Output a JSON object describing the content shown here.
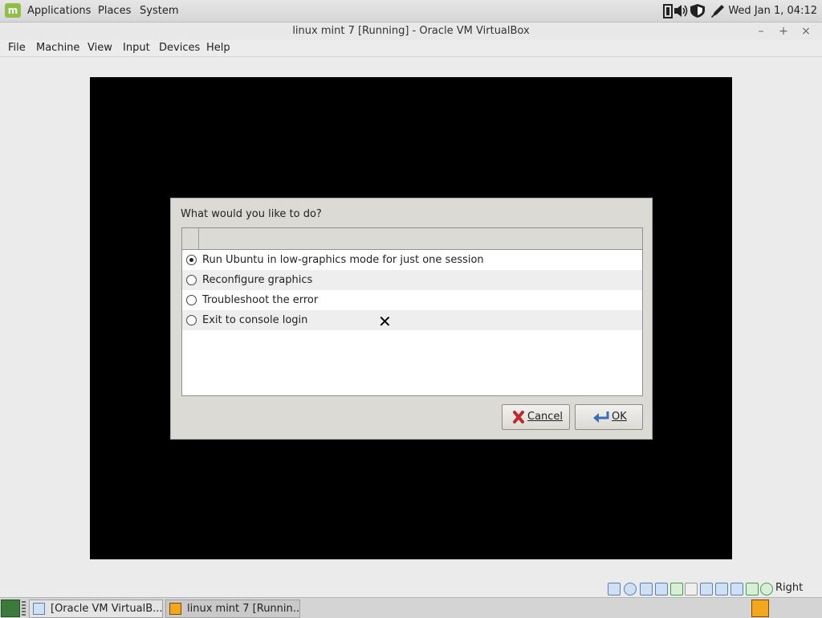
{
  "top_panel": {
    "logo_text": "m",
    "menus": [
      "Applications",
      "Places",
      "System"
    ],
    "clock": "Wed Jan  1, 04:12",
    "tray_icons": [
      "network-icon",
      "volume-icon",
      "shield-icon",
      "pen-icon"
    ]
  },
  "window": {
    "title": "linux mint 7 [Running] - Oracle VM VirtualBox",
    "controls": [
      "–",
      "+",
      "×"
    ],
    "menus": [
      "File",
      "Machine",
      "View",
      "Input",
      "Devices",
      "Help"
    ]
  },
  "dialog": {
    "prompt": "What would you like to do?",
    "options": [
      {
        "label": "Run Ubuntu in low-graphics mode for just one session",
        "selected": true
      },
      {
        "label": "Reconfigure graphics",
        "selected": false
      },
      {
        "label": "Troubleshoot the error",
        "selected": false
      },
      {
        "label": "Exit to console login",
        "selected": false
      }
    ],
    "cancel_label": "Cancel",
    "ok_label": "OK"
  },
  "cursor_glyph": "✕",
  "statusbar": {
    "host_key": "Right Ctrl"
  },
  "taskbar": {
    "tasks": [
      {
        "label": "[Oracle VM VirtualB...",
        "active": false
      },
      {
        "label": "linux mint 7 [Runnin...",
        "active": true
      }
    ]
  }
}
